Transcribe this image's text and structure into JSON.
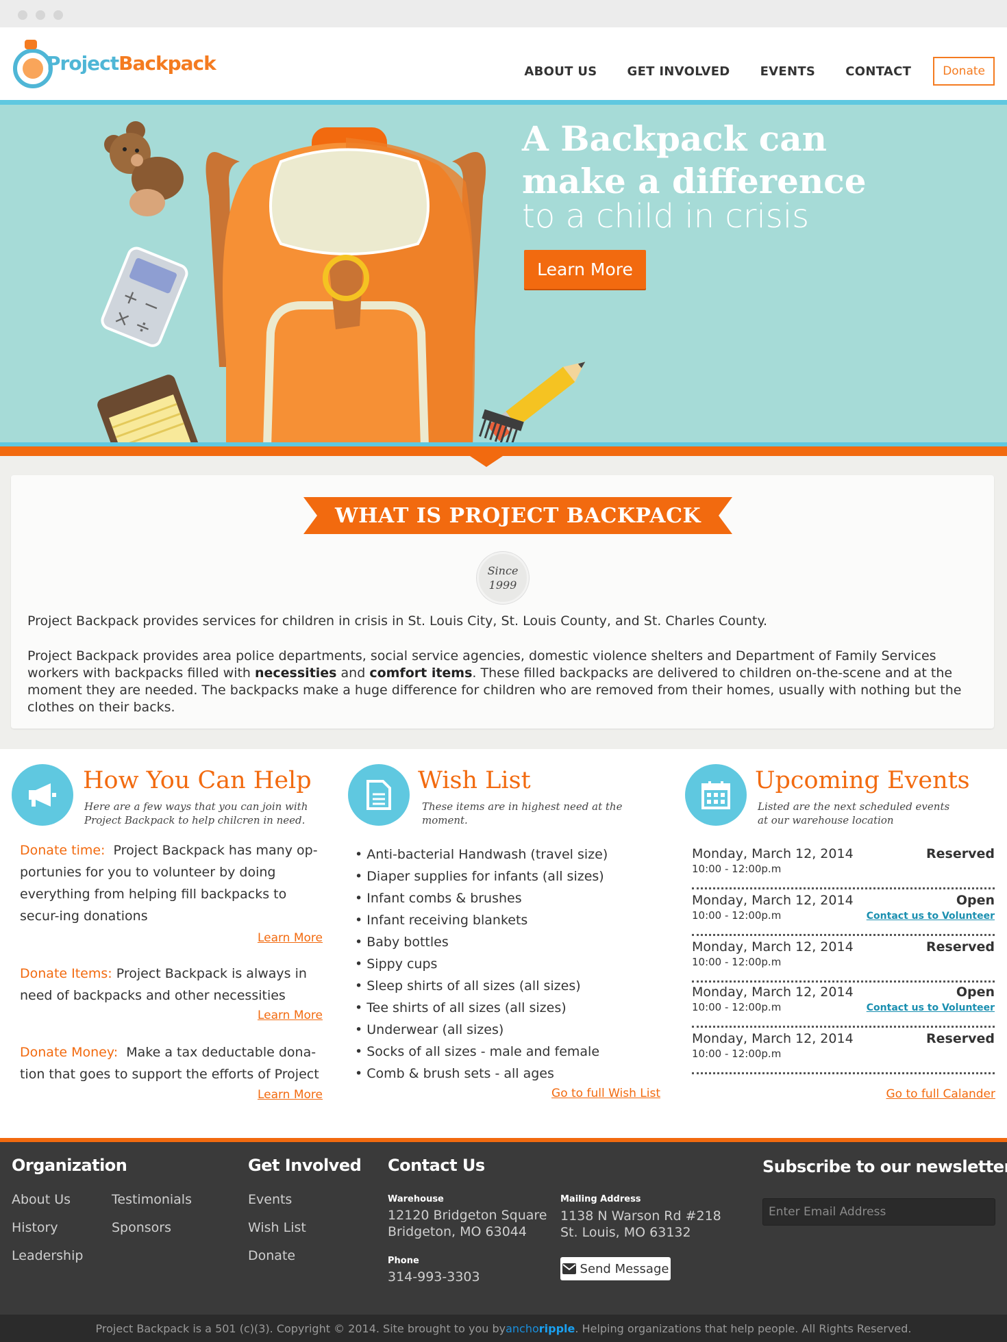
{
  "header": {
    "logo": "Project Backpack",
    "logo_part1": "Project",
    "logo_part2": "Backpack",
    "nav": [
      "ABOUT US",
      "GET INVOLVED",
      "EVENTS",
      "CONTACT"
    ],
    "donate_label": "Donate"
  },
  "hero": {
    "title_line1": "A Backpack can",
    "title_line2": "make a difference",
    "subtitle": "to a child in crisis",
    "button": "Learn More"
  },
  "about": {
    "heading": "WHAT IS PROJECT BACKPACK",
    "since_label": "Since",
    "since_year": "1999",
    "p1": "Project Backpack provides services for children in crisis in St. Louis City, St. Louis County, and St. Charles County.",
    "p2_a": "Project Backpack provides area police departments, social service agencies, domestic violence shelters and Department of Family Services workers with backpacks filled with ",
    "p2_b": "necessities",
    "p2_c": " and ",
    "p2_d": "comfort items",
    "p2_e": ".  These filled backpacks are delivered to children on-the-scene and at the moment they are needed.  The backpacks make a huge difference for children who are removed from their homes, usually with nothing but the clothes on their backs."
  },
  "help": {
    "title": "How You Can Help",
    "subtitle_line1": "Here are a few ways that you can join with",
    "subtitle_line2": "Project Backpack to help chilcren in need.",
    "items": [
      {
        "label": "Donate time:",
        "text": "Project Backpack has many op-portunies for you to volunteer by doing everything from helping fill backpacks to secur-ing donations",
        "link": "Learn More"
      },
      {
        "label": "Donate Items:",
        "text": "Project Backpack is always in need of backpacks and other necessities",
        "link": "Learn More"
      },
      {
        "label": "Donate Money:",
        "text": "Make a tax deductable dona-tion that goes to support the efforts of Project",
        "link": "Learn More"
      }
    ]
  },
  "wishlist": {
    "title": "Wish List",
    "subtitle": "These items are in highest need at the moment.",
    "items": [
      "• Anti-bacterial Handwash  (travel size)",
      "• Diaper supplies for infants (all sizes)",
      "• Infant combs & brushes",
      "• Infant receiving blankets",
      "• Baby bottles",
      "• Sippy cups",
      "• Sleep shirts of all sizes (all sizes)",
      "• Tee shirts of all sizes (all sizes)",
      "• Underwear (all sizes)",
      "• Socks of all sizes - male and female",
      "• Comb & brush sets - all ages"
    ],
    "link": "Go to full Wish List"
  },
  "events": {
    "title": "Upcoming Events",
    "subtitle_line1": "Listed are the next scheduled events",
    "subtitle_line2": "at our warehouse location",
    "items": [
      {
        "date": "Monday, March 12, 2014",
        "time": "10:00 - 12:00p.m",
        "status": "Reserved",
        "link": ""
      },
      {
        "date": "Monday, March 12, 2014",
        "time": "10:00 - 12:00p.m",
        "status": "Open",
        "link": "Contact us to Volunteer"
      },
      {
        "date": "Monday, March 12, 2014",
        "time": "10:00 - 12:00p.m",
        "status": "Reserved",
        "link": ""
      },
      {
        "date": "Monday, March 12, 2014",
        "time": "10:00 - 12:00p.m",
        "status": "Open",
        "link": "Contact us to Volunteer"
      },
      {
        "date": "Monday, March 12, 2014",
        "time": "10:00 - 12:00p.m",
        "status": "Reserved",
        "link": ""
      }
    ],
    "link": "Go to full Calander"
  },
  "footer": {
    "org_title": "Organization",
    "org_links": [
      "About Us",
      "History",
      "Leadership",
      "Testimonials",
      "Sponsors"
    ],
    "involved_title": "Get Involved",
    "involved_links": [
      "Events",
      "Wish List",
      "Donate"
    ],
    "contact_title": "Contact Us",
    "warehouse_label": "Warehouse",
    "warehouse_line1": "12120 Bridgeton Square",
    "warehouse_line2": "Bridgeton, MO 63044",
    "phone_label": "Phone",
    "phone": "314-993-3303",
    "mailing_label": "Mailing Address",
    "mailing_line1": "1138 N Warson Rd #218",
    "mailing_line2": "St. Louis, MO 63132",
    "send_button": "Send Message",
    "newsletter_title": "Subscribe to our newsletter",
    "email_placeholder": "Enter Email Address",
    "bottom_a": "Project Backpack is a 501 (c)(3).   Copyright © 2014.  Site brought to you by ",
    "bottom_brand1": "ancho",
    "bottom_brand2": "ripple",
    "bottom_b": ". Helping organizations that help people. All Rights Reserved."
  },
  "colors": {
    "accent_orange": "#f26a0f",
    "accent_blue": "#5fc8e0",
    "hero_bg": "#a6dbd7",
    "footer_bg": "#3a3a3a"
  }
}
